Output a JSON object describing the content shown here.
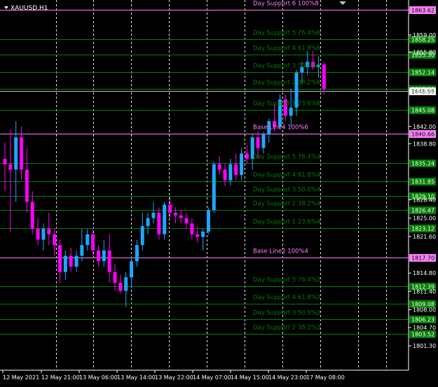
{
  "window": {
    "symbol_label": "XAUUSD,H1"
  },
  "colors": {
    "background": "#000000",
    "bull": "#1ea7fd",
    "bear": "#ff00ff",
    "support": "#008000",
    "base": "#ff80ff",
    "grid": "#ffffff",
    "axis_text": "#ffffff"
  },
  "chart_data": {
    "type": "candlestick",
    "x_tick_labels": [
      "12 May 2021",
      "12 May 21:00",
      "13 May 06:00",
      "13 May 14:00",
      "13 May 22:00",
      "14 May 07:00",
      "14 May 15:00",
      "14 May 23:00",
      "17 May 08:00"
    ],
    "y_tick_labels": [
      "1859.00",
      "1855.80",
      "1848.60",
      "1842.00",
      "1838.80",
      "1828.40",
      "1825.00",
      "1821.60",
      "1814.80",
      "1811.40",
      "1808.00",
      "1804.70",
      "1801.30"
    ],
    "ylim": [
      1800.0,
      1864.5
    ],
    "grid": "dashed vertical",
    "level_lines": [
      {
        "text": "Day Support 6 100%8",
        "price": 1863.62,
        "tag": "1863.62",
        "kind": "base"
      },
      {
        "text": "Day Support 5 76.4%6",
        "price": 1858.25,
        "tag": "1858.25",
        "kind": "support"
      },
      {
        "text": "Day Support 4 61.8%6",
        "price": 1855.3,
        "tag": "1855.30",
        "kind": "support"
      },
      {
        "text": "Day Support 3 50.0%6",
        "price": 1852.14,
        "tag": "1852.14",
        "kind": "support"
      },
      {
        "text": "Day Support 2 38.2%6",
        "price": 1848.98,
        "tag": "1848.98",
        "kind": "support"
      },
      {
        "text": "Day Support 1 23.6%6",
        "price": 1845.08,
        "tag": "1845.08",
        "kind": "support"
      },
      {
        "text": "Base Line4 100%6",
        "price": 1840.66,
        "tag": "1840.66",
        "kind": "base"
      },
      {
        "text": "Day Support 5 76.4%4",
        "price": 1835.24,
        "tag": "1835.24",
        "kind": "support"
      },
      {
        "text": "Day Support 4 61.8%4",
        "price": 1831.85,
        "tag": "1831.85",
        "kind": "support"
      },
      {
        "text": "Day Support 3 50.0%4",
        "price": 1829.1,
        "tag": "1829.10",
        "kind": "support"
      },
      {
        "text": "Day Support 2 38.2%4",
        "price": 1826.47,
        "tag": "1826.47",
        "kind": "support"
      },
      {
        "text": "Day Support 1 23.6%4",
        "price": 1823.12,
        "tag": "1823.12",
        "kind": "support"
      },
      {
        "text": "Base Line2 100%4",
        "price": 1817.7,
        "tag": "1817.70",
        "kind": "base"
      },
      {
        "text": "Day Support 5 76.4%2",
        "price": 1812.39,
        "tag": "1812.39",
        "kind": "support"
      },
      {
        "text": "Day Support 4 61.8%2",
        "price": 1809.08,
        "tag": "1809.08",
        "kind": "support"
      },
      {
        "text": "Day Support 3 50.0%2",
        "price": 1806.23,
        "tag": "1806.23",
        "kind": "support"
      },
      {
        "text": "Day Support 2 38.2%2",
        "price": 1803.52,
        "tag": "1803.52",
        "kind": "support"
      }
    ],
    "current_price": {
      "price": 1848.98,
      "tag": "1848.98"
    },
    "candles": [
      {
        "o": 1836.0,
        "h": 1839.0,
        "l": 1830.0,
        "c": 1835.0
      },
      {
        "o": 1835.0,
        "h": 1841.5,
        "l": 1822.5,
        "c": 1834.0
      },
      {
        "o": 1834.0,
        "h": 1843.0,
        "l": 1828.0,
        "c": 1840.0
      },
      {
        "o": 1840.0,
        "h": 1842.0,
        "l": 1832.0,
        "c": 1834.0
      },
      {
        "o": 1834.0,
        "h": 1838.0,
        "l": 1826.0,
        "c": 1828.0
      },
      {
        "o": 1828.0,
        "h": 1830.0,
        "l": 1822.0,
        "c": 1823.0
      },
      {
        "o": 1823.0,
        "h": 1825.0,
        "l": 1820.0,
        "c": 1821.0
      },
      {
        "o": 1821.0,
        "h": 1824.0,
        "l": 1819.0,
        "c": 1823.0
      },
      {
        "o": 1823.0,
        "h": 1826.0,
        "l": 1820.0,
        "c": 1822.0
      },
      {
        "o": 1822.0,
        "h": 1823.0,
        "l": 1818.0,
        "c": 1820.0
      },
      {
        "o": 1820.0,
        "h": 1821.0,
        "l": 1813.0,
        "c": 1815.0
      },
      {
        "o": 1815.0,
        "h": 1819.0,
        "l": 1813.5,
        "c": 1818.0
      },
      {
        "o": 1818.0,
        "h": 1819.5,
        "l": 1815.0,
        "c": 1816.0
      },
      {
        "o": 1816.0,
        "h": 1819.0,
        "l": 1815.0,
        "c": 1818.0
      },
      {
        "o": 1818.0,
        "h": 1823.0,
        "l": 1817.0,
        "c": 1820.0
      },
      {
        "o": 1820.0,
        "h": 1823.0,
        "l": 1819.0,
        "c": 1822.0
      },
      {
        "o": 1822.0,
        "h": 1823.0,
        "l": 1818.0,
        "c": 1819.0
      },
      {
        "o": 1819.0,
        "h": 1820.0,
        "l": 1816.0,
        "c": 1817.0
      },
      {
        "o": 1817.0,
        "h": 1821.0,
        "l": 1816.0,
        "c": 1819.0
      },
      {
        "o": 1819.0,
        "h": 1822.0,
        "l": 1813.0,
        "c": 1815.0
      },
      {
        "o": 1815.0,
        "h": 1816.5,
        "l": 1811.5,
        "c": 1813.0
      },
      {
        "o": 1813.0,
        "h": 1814.5,
        "l": 1811.0,
        "c": 1811.5
      },
      {
        "o": 1811.5,
        "h": 1815.0,
        "l": 1808.5,
        "c": 1814.0
      },
      {
        "o": 1814.0,
        "h": 1818.0,
        "l": 1812.0,
        "c": 1817.0
      },
      {
        "o": 1817.0,
        "h": 1821.0,
        "l": 1816.0,
        "c": 1820.0
      },
      {
        "o": 1820.0,
        "h": 1826.0,
        "l": 1819.0,
        "c": 1823.5
      },
      {
        "o": 1823.5,
        "h": 1826.0,
        "l": 1822.0,
        "c": 1825.0
      },
      {
        "o": 1825.0,
        "h": 1828.0,
        "l": 1824.0,
        "c": 1826.0
      },
      {
        "o": 1826.0,
        "h": 1827.0,
        "l": 1821.0,
        "c": 1822.0
      },
      {
        "o": 1822.0,
        "h": 1828.0,
        "l": 1821.0,
        "c": 1827.5
      },
      {
        "o": 1827.5,
        "h": 1829.0,
        "l": 1825.0,
        "c": 1826.0
      },
      {
        "o": 1826.0,
        "h": 1827.0,
        "l": 1824.0,
        "c": 1825.5
      },
      {
        "o": 1825.5,
        "h": 1826.5,
        "l": 1824.0,
        "c": 1825.0
      },
      {
        "o": 1825.0,
        "h": 1826.0,
        "l": 1823.0,
        "c": 1824.0
      },
      {
        "o": 1824.0,
        "h": 1825.0,
        "l": 1821.0,
        "c": 1822.0
      },
      {
        "o": 1822.0,
        "h": 1823.5,
        "l": 1820.5,
        "c": 1821.5
      },
      {
        "o": 1821.5,
        "h": 1823.0,
        "l": 1819.0,
        "c": 1822.5
      },
      {
        "o": 1822.5,
        "h": 1827.0,
        "l": 1822.0,
        "c": 1826.5
      },
      {
        "o": 1826.5,
        "h": 1835.5,
        "l": 1826.0,
        "c": 1835.0
      },
      {
        "o": 1835.0,
        "h": 1836.5,
        "l": 1833.0,
        "c": 1834.0
      },
      {
        "o": 1834.0,
        "h": 1835.0,
        "l": 1831.0,
        "c": 1832.0
      },
      {
        "o": 1832.0,
        "h": 1836.0,
        "l": 1831.0,
        "c": 1835.0
      },
      {
        "o": 1835.0,
        "h": 1837.0,
        "l": 1832.0,
        "c": 1833.0
      },
      {
        "o": 1833.0,
        "h": 1838.0,
        "l": 1832.0,
        "c": 1837.0
      },
      {
        "o": 1837.0,
        "h": 1838.5,
        "l": 1835.0,
        "c": 1836.0
      },
      {
        "o": 1836.0,
        "h": 1840.5,
        "l": 1834.0,
        "c": 1840.0
      },
      {
        "o": 1840.0,
        "h": 1841.0,
        "l": 1836.0,
        "c": 1838.0
      },
      {
        "o": 1838.0,
        "h": 1841.0,
        "l": 1837.0,
        "c": 1840.5
      },
      {
        "o": 1840.5,
        "h": 1843.5,
        "l": 1839.0,
        "c": 1843.0
      },
      {
        "o": 1843.0,
        "h": 1846.0,
        "l": 1841.0,
        "c": 1842.0
      },
      {
        "o": 1842.0,
        "h": 1848.0,
        "l": 1841.5,
        "c": 1847.0
      },
      {
        "o": 1847.0,
        "h": 1848.0,
        "l": 1843.0,
        "c": 1844.0
      },
      {
        "o": 1844.0,
        "h": 1849.0,
        "l": 1842.0,
        "c": 1845.5
      },
      {
        "o": 1845.5,
        "h": 1852.5,
        "l": 1844.0,
        "c": 1852.0
      },
      {
        "o": 1852.0,
        "h": 1854.0,
        "l": 1850.0,
        "c": 1853.0
      },
      {
        "o": 1853.0,
        "h": 1856.0,
        "l": 1851.5,
        "c": 1854.0
      },
      {
        "o": 1854.0,
        "h": 1856.0,
        "l": 1852.5,
        "c": 1853.0
      },
      {
        "o": 1853.0,
        "h": 1855.0,
        "l": 1851.0,
        "c": 1853.5
      },
      {
        "o": 1853.5,
        "h": 1854.0,
        "l": 1848.0,
        "c": 1849.0
      }
    ]
  }
}
